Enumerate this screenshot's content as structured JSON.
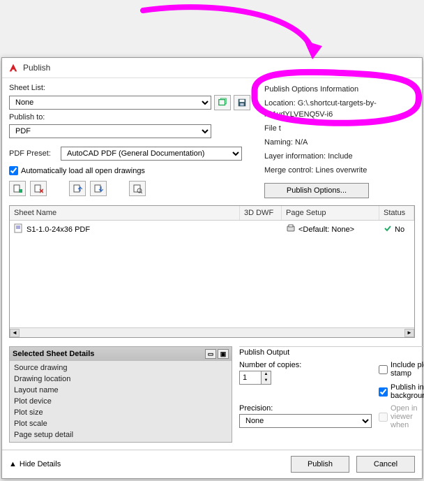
{
  "dialog": {
    "title": "Publish",
    "sheet_list_label": "Sheet List:",
    "sheet_list_value": "None",
    "publish_to_label": "Publish to:",
    "publish_to_value": "PDF",
    "pdf_preset_label": "PDF Preset:",
    "pdf_preset_value": "AutoCAD PDF (General Documentation)",
    "auto_load_label": "Automatically load all open drawings"
  },
  "options_info": {
    "heading": "Publish Options Information",
    "location_label": "Location:",
    "location_value": "G:\\.shortcut-targets-by-id\\1vdYLVENQ5V-i6",
    "file_type_label": "File t",
    "naming_label": "Naming:",
    "naming_value": "N/A",
    "layer_label": "Layer information:",
    "layer_value": "Include",
    "merge_label": "Merge control:",
    "merge_value": "Lines overwrite",
    "options_button": "Publish Options..."
  },
  "grid": {
    "col_sheet": "Sheet Name",
    "col_3d": "3D DWF",
    "col_ps": "Page Setup",
    "col_status": "Status",
    "rows": [
      {
        "sheet": "S1-1.0-24x36 PDF",
        "page_setup": "<Default: None>",
        "status": "No"
      }
    ]
  },
  "details": {
    "heading": "Selected Sheet Details",
    "rows": [
      "Source drawing",
      "Drawing location",
      "Layout name",
      "Plot device",
      "Plot size",
      "Plot scale",
      "Page setup detail"
    ]
  },
  "output": {
    "heading": "Publish Output",
    "copies_label": "Number of copies:",
    "copies_value": "1",
    "precision_label": "Precision:",
    "precision_value": "None",
    "include_stamp": "Include plot stamp",
    "publish_bg": "Publish in background",
    "open_viewer": "Open in viewer when"
  },
  "footer": {
    "hide_details": "Hide Details",
    "publish": "Publish",
    "cancel": "Cancel"
  }
}
